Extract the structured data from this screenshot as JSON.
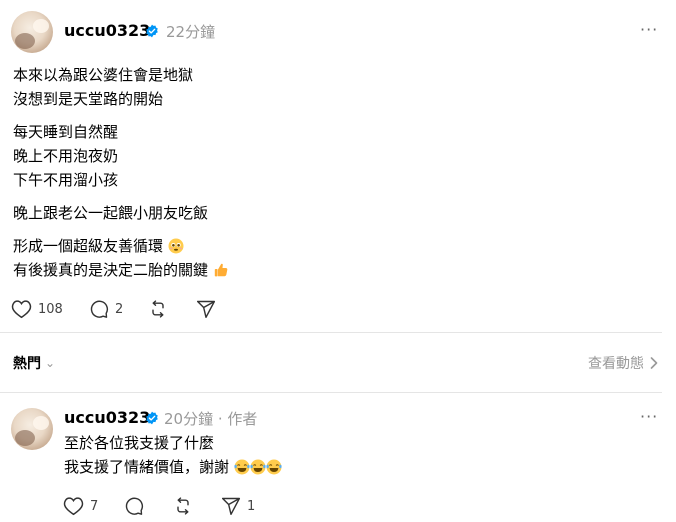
{
  "post": {
    "username": "uccu0323",
    "time": "22分鐘",
    "lines": [
      "本來以為跟公婆住會是地獄",
      "沒想到是天堂路的開始",
      "每天睡到自然醒",
      "晚上不用泡夜奶",
      "下午不用溜小孩",
      "晚上跟老公一起餵小朋友吃飯",
      "形成一個超級友善循環",
      "有後援真的是決定二胎的關鍵"
    ],
    "likes": "108",
    "comments": "2"
  },
  "section": {
    "sort_label": "熱門",
    "view_activity": "查看動態"
  },
  "reply": {
    "username": "uccu0323",
    "time": "20分鐘",
    "author_tag": "作者",
    "lines": [
      "至於各位我支援了什麼",
      "我支援了情緒價值，謝謝"
    ],
    "likes": "7",
    "shares": "1"
  },
  "colors": {
    "verified": "#0095f6",
    "muted": "#999999",
    "divider": "#e5e5e5"
  }
}
